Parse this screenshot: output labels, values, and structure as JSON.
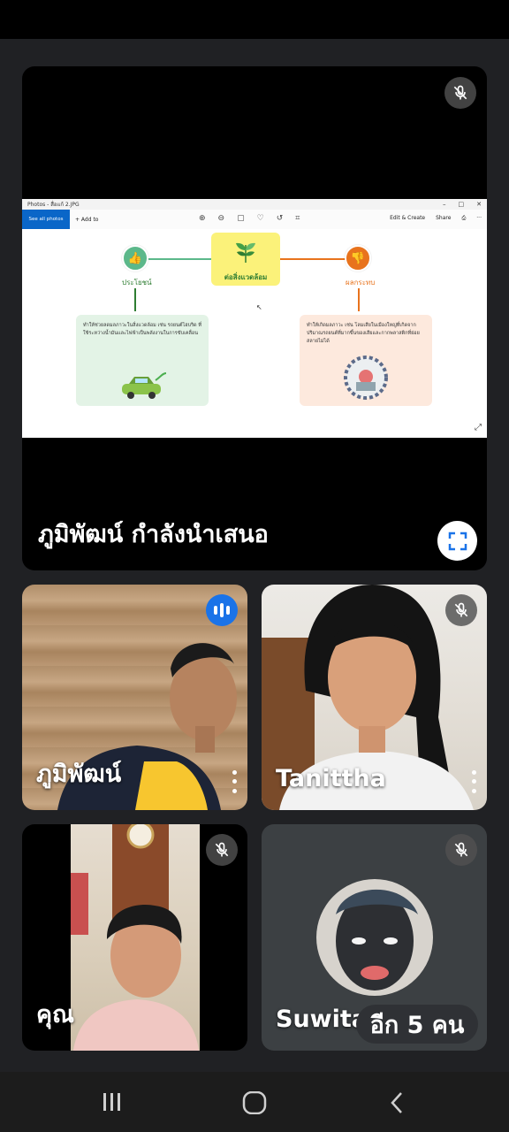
{
  "presentation": {
    "presenter_label": "ภูมิพัฒน์ กำลังนำเสนอ",
    "shared_window": {
      "title": "Photos - สื่อแก้ 2.JPG",
      "see_all": "See all photos",
      "add_to": "+ Add to",
      "edit_create": "Edit & Create",
      "share": "Share"
    },
    "slide": {
      "center_label": "ต่อสิ่งแวดล้อม",
      "benefit_label": "ประโยชน์",
      "impact_label": "ผลกระทบ",
      "benefit_text": "ทำให้ช่วยลดมลภาวะในสิ่งแวดล้อม เช่น รถยนต์ไฮบริด ที่ใช้ระหว่างน้ำมันและไฟฟ้าเป็นพลังงานในการขับเคลื่อน",
      "impact_text": "ทำให้เกิดมลภาวะ เช่น โลมเสียในเมืองใหญ่ที่เกิดจากปริมาณรถยนต์ที่มากขึ้นของเสียและกากพลาสติกที่ย่อยสลายไม่ได้"
    }
  },
  "participants": [
    {
      "name": "ภูมิพัฒน์",
      "status": "speaking"
    },
    {
      "name": "Tanittha",
      "status": "muted"
    },
    {
      "name": "คุณ",
      "status": "muted"
    },
    {
      "name": "Suwita",
      "status": "muted"
    }
  ],
  "more_participants": "อีก 5 คน",
  "colors": {
    "background": "#202124",
    "speaking": "#1a73e8",
    "fullscreen_icon": "#1a73e8"
  },
  "icons": [
    "mic-off-icon",
    "fullscreen-icon",
    "speaking-icon",
    "more-options-icon",
    "recents-icon",
    "home-icon",
    "back-icon"
  ]
}
